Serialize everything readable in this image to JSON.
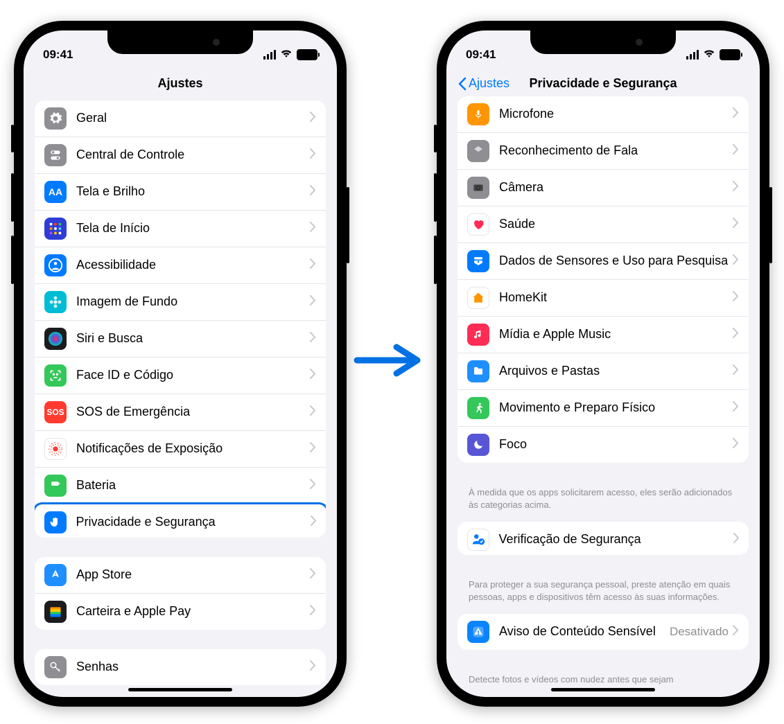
{
  "status": {
    "time": "09:41"
  },
  "leftPhone": {
    "title": "Ajustes",
    "groups": [
      {
        "items": [
          {
            "name": "geral",
            "label": "Geral",
            "icon": {
              "bg": "#8e8e93",
              "svg": "gear"
            }
          },
          {
            "name": "central-controle",
            "label": "Central de Controle",
            "icon": {
              "bg": "#8e8e93",
              "svg": "switches"
            }
          },
          {
            "name": "tela-brilho",
            "label": "Tela e Brilho",
            "icon": {
              "bg": "#007aff",
              "svg": "aa"
            }
          },
          {
            "name": "tela-inicio",
            "label": "Tela de Início",
            "icon": {
              "bg": "#2f3cd6",
              "svg": "grid"
            }
          },
          {
            "name": "acessibilidade",
            "label": "Acessibilidade",
            "icon": {
              "bg": "#007aff",
              "svg": "person-circle"
            }
          },
          {
            "name": "imagem-fundo",
            "label": "Imagem de Fundo",
            "icon": {
              "bg": "#00bcd4",
              "svg": "flower"
            }
          },
          {
            "name": "siri-busca",
            "label": "Siri e Busca",
            "icon": {
              "bg": "#1c1c1e",
              "svg": "siri"
            }
          },
          {
            "name": "face-id",
            "label": "Face ID e Código",
            "icon": {
              "bg": "#34c759",
              "svg": "faceid"
            }
          },
          {
            "name": "sos",
            "label": "SOS de Emergência",
            "icon": {
              "bg": "#ff3b30",
              "svg": "sos"
            }
          },
          {
            "name": "notif-exposicao",
            "label": "Notificações de Exposição",
            "icon": {
              "bg": "#fff",
              "svg": "exposure"
            }
          },
          {
            "name": "bateria",
            "label": "Bateria",
            "icon": {
              "bg": "#34c759",
              "svg": "battery"
            }
          },
          {
            "name": "privacidade",
            "label": "Privacidade e Segurança",
            "icon": {
              "bg": "#007aff",
              "svg": "hand"
            },
            "highlighted": true
          }
        ]
      },
      {
        "items": [
          {
            "name": "app-store",
            "label": "App Store",
            "icon": {
              "bg": "#1f8fff",
              "svg": "appstore"
            }
          },
          {
            "name": "carteira",
            "label": "Carteira e Apple Pay",
            "icon": {
              "bg": "#1c1c1e",
              "svg": "wallet"
            }
          }
        ]
      },
      {
        "items": [
          {
            "name": "senhas",
            "label": "Senhas",
            "icon": {
              "bg": "#8e8e93",
              "svg": "key"
            }
          }
        ]
      }
    ]
  },
  "rightPhone": {
    "backLabel": "Ajustes",
    "title": "Privacidade e Segurança",
    "groups": [
      {
        "items": [
          {
            "name": "microfone",
            "label": "Microfone",
            "icon": {
              "bg": "#ff9500",
              "svg": "mic"
            }
          },
          {
            "name": "reconhecimento-fala",
            "label": "Reconhecimento de Fala",
            "icon": {
              "bg": "#8e8e93",
              "svg": "wave"
            }
          },
          {
            "name": "camera",
            "label": "Câmera",
            "icon": {
              "bg": "#8e8e93",
              "svg": "camera"
            }
          },
          {
            "name": "saude",
            "label": "Saúde",
            "icon": {
              "bg": "#fff",
              "svg": "heart"
            }
          },
          {
            "name": "dados-sensores",
            "label": "Dados de Sensores e Uso para Pesquisa",
            "icon": {
              "bg": "#007aff",
              "svg": "research"
            }
          },
          {
            "name": "homekit",
            "label": "HomeKit",
            "icon": {
              "bg": "#fff",
              "svg": "home"
            }
          },
          {
            "name": "midia-music",
            "label": "Mídia e Apple Music",
            "icon": {
              "bg": "#ff2d55",
              "svg": "music"
            }
          },
          {
            "name": "arquivos",
            "label": "Arquivos e Pastas",
            "icon": {
              "bg": "#1f8fff",
              "svg": "folder"
            }
          },
          {
            "name": "movimento",
            "label": "Movimento e Preparo Físico",
            "icon": {
              "bg": "#34c759",
              "svg": "runner"
            }
          },
          {
            "name": "foco",
            "label": "Foco",
            "icon": {
              "bg": "#5856d6",
              "svg": "moon"
            }
          }
        ],
        "footer": "À medida que os apps solicitarem acesso, eles serão adicionados às categorias acima."
      },
      {
        "items": [
          {
            "name": "verificacao-seguranca",
            "label": "Verificação de Segurança",
            "icon": {
              "bg": "#fff",
              "svg": "safety"
            },
            "highlighted": true
          }
        ],
        "footer": "Para proteger a sua segurança pessoal, preste atenção em quais pessoas, apps e dispositivos têm acesso às suas informações."
      },
      {
        "items": [
          {
            "name": "aviso-conteudo",
            "label": "Aviso de Conteúdo Sensível",
            "detail": "Desativado",
            "icon": {
              "bg": "#0a84ff",
              "svg": "warning"
            }
          }
        ],
        "footer": "Detecte fotos e vídeos com nudez antes que sejam"
      }
    ]
  }
}
